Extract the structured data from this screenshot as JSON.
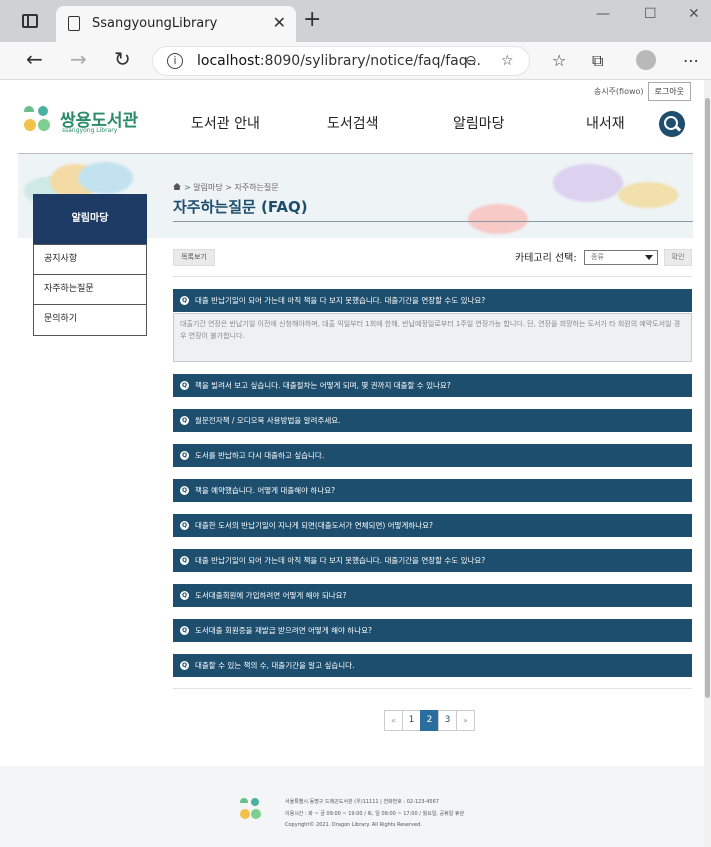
{
  "browser": {
    "tab_title": "SsangyoungLibrary",
    "url_host": "localhost",
    "url_rest": ":8090/sylibrary/notice/faq/faq..."
  },
  "header": {
    "user_label": "송시주(fiowo)",
    "logout_label": "로그아웃",
    "logo_name": "쌍용도서관",
    "logo_sub": "ssangyong Library",
    "nav": [
      "도서관 안내",
      "도서검색",
      "알림마당",
      "내서재"
    ]
  },
  "banner": {
    "breadcrumb": "> 알림마당 > 자주하는질문",
    "title": "자주하는질문 (FAQ)"
  },
  "sidebar": {
    "heading": "알림마당",
    "items": [
      "공지사항",
      "자주하는질문",
      "문의하기"
    ]
  },
  "controls": {
    "list_button": "목록보기",
    "category_label": "카테고리 선택:",
    "category_value": "종류",
    "confirm_button": "확인"
  },
  "faq": {
    "items": [
      "대출 반납기일이 되어 가는데 아직 책을 다 보지 못했습니다. 대출기간을 연장할 수도 있나요?",
      "책을 빌려서 보고 싶습니다. 대출절차는 어떻게 되며, 몇 권까지 대출할 수 있나요?",
      "월문전자책 / 오디오북 사용방법을 알려주세요.",
      "도서를 반납하고 다시 대출하고 싶습니다.",
      "책을 예약했습니다. 어떻게 대출해야 하나요?",
      "대출한 도서의 반납기일이 지나게 되면(대출도서가 연체되면) 어떻게하나요?",
      "대출 반납기일이 되어 가는데 아직 책을 다 보지 못했습니다. 대출기간을 연장할 수도 있나요?",
      "도서대출회원에 가입하려면 어떻게 해야 되나요?",
      "도서대출 회원증을 재발급 받으려면 어떻게 해야 하나요?",
      "대출할 수 있는 책의 수, 대출기간을 알고 싶습니다."
    ],
    "answer": "대출기간 연장은 반납기일 이전에 신청해야하며, 대출 익일부터 1회에 한해, 반납예정일로부터 1주일 연장가능 합니다. 단, 연장을 희망하는 도서가 타 회원의 예약도서일 경우 연장이 불가합니다."
  },
  "pagination": {
    "prev": "«",
    "pages": [
      "1",
      "2",
      "3"
    ],
    "next": "»"
  },
  "footer": {
    "line1": "서울특별시 동명구 드래곤도서관 (우)11111 | 전화번호 : 02-123-4567",
    "line2": "이용시간 : 화 ~ 금 09:00 ~ 19:00 / 토, 일 09:00 ~ 17:00 / 월요일, 공휴일 휴관",
    "line3": "Copyright© 2021. Dragon Library. All Rights Reserved."
  },
  "colors": {
    "primary": "#1d4e6e",
    "sidebar_head": "#1d3b64",
    "active_page": "#2a6ea0"
  }
}
